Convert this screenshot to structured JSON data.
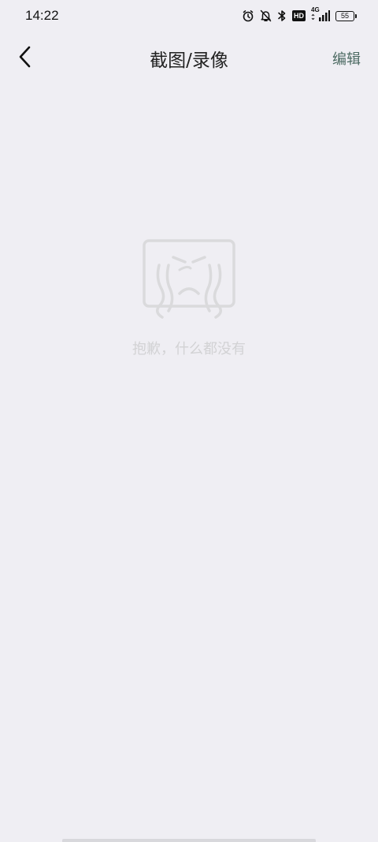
{
  "status_bar": {
    "time": "14:22",
    "hd": "HD",
    "network": "4G",
    "battery": "55",
    "icons": [
      "alarm-icon",
      "mute-bell-icon",
      "bluetooth-icon",
      "hd-icon",
      "signal-icon",
      "battery-icon"
    ]
  },
  "nav": {
    "title": "截图/录像",
    "edit_label": "编辑",
    "back_icon": "chevron-left-icon"
  },
  "empty_state": {
    "message": "抱歉，什么都没有",
    "illustration": "crying-face-icon"
  },
  "colors": {
    "background": "#efeef3",
    "accent": "#4d6b63",
    "empty_text": "#d2d2d4"
  }
}
